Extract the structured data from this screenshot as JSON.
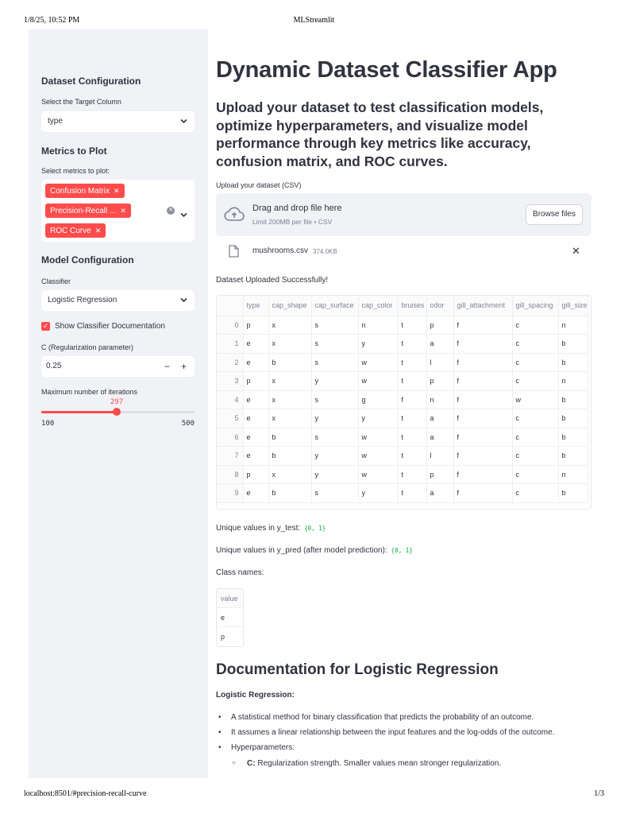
{
  "print_header": {
    "datetime": "1/8/25, 10:52 PM",
    "title": "MLStreamlit"
  },
  "print_footer": {
    "url": "localhost:8501/#precision-recall-curve",
    "page": "1/3"
  },
  "sidebar": {
    "dataset_config": {
      "heading": "Dataset Configuration",
      "target_label": "Select the Target Column",
      "target_value": "type"
    },
    "metrics": {
      "heading": "Metrics to Plot",
      "label": "Select metrics to plot:",
      "selected": [
        "Confusion Matrix",
        "Precision-Recall ...",
        "ROC Curve"
      ]
    },
    "model_config": {
      "heading": "Model Configuration",
      "classifier_label": "Classifier",
      "classifier_value": "Logistic Regression",
      "show_docs_label": "Show Classifier Documentation",
      "show_docs_checked": true,
      "c_label": "C (Regularization parameter)",
      "c_value": "0.25",
      "iter_label": "Maximum number of iterations",
      "iter_value": "297",
      "iter_min": "100",
      "iter_max": "500"
    }
  },
  "main": {
    "title": "Dynamic Dataset Classifier App",
    "subtitle": "Upload your dataset to test classification models, optimize hyperparameters, and visualize model performance through key metrics like accuracy, confusion matrix, and ROC curves.",
    "upload": {
      "label": "Upload your dataset (CSV)",
      "drag_text": "Drag and drop file here",
      "limit_text": "Limit 200MB per file • CSV",
      "browse_label": "Browse files",
      "file_name": "mushrooms.csv",
      "file_size": "374.0KB"
    },
    "uploaded_msg": "Dataset Uploaded Successfully!",
    "dataframe": {
      "columns": [
        "type",
        "cap_shape",
        "cap_surface",
        "cap_color",
        "bruises",
        "odor",
        "gill_attachment",
        "gill_spacing",
        "gill_size"
      ],
      "rows": [
        {
          "idx": "0",
          "cells": [
            "p",
            "x",
            "s",
            "n",
            "t",
            "p",
            "f",
            "c",
            "n"
          ]
        },
        {
          "idx": "1",
          "cells": [
            "e",
            "x",
            "s",
            "y",
            "t",
            "a",
            "f",
            "c",
            "b"
          ]
        },
        {
          "idx": "2",
          "cells": [
            "e",
            "b",
            "s",
            "w",
            "t",
            "l",
            "f",
            "c",
            "b"
          ]
        },
        {
          "idx": "3",
          "cells": [
            "p",
            "x",
            "y",
            "w",
            "t",
            "p",
            "f",
            "c",
            "n"
          ]
        },
        {
          "idx": "4",
          "cells": [
            "e",
            "x",
            "s",
            "g",
            "f",
            "n",
            "f",
            "w",
            "b"
          ]
        },
        {
          "idx": "5",
          "cells": [
            "e",
            "x",
            "y",
            "y",
            "t",
            "a",
            "f",
            "c",
            "b"
          ]
        },
        {
          "idx": "6",
          "cells": [
            "e",
            "b",
            "s",
            "w",
            "t",
            "a",
            "f",
            "c",
            "b"
          ]
        },
        {
          "idx": "7",
          "cells": [
            "e",
            "b",
            "y",
            "w",
            "t",
            "l",
            "f",
            "c",
            "b"
          ]
        },
        {
          "idx": "8",
          "cells": [
            "p",
            "x",
            "y",
            "w",
            "t",
            "p",
            "f",
            "c",
            "n"
          ]
        },
        {
          "idx": "9",
          "cells": [
            "e",
            "b",
            "s",
            "y",
            "t",
            "a",
            "f",
            "c",
            "b"
          ]
        }
      ]
    },
    "unique_test_label": "Unique values in y_test:",
    "unique_test_value": "{0, 1}",
    "unique_pred_label": "Unique values in y_pred (after model prediction):",
    "unique_pred_value": "{0, 1}",
    "class_names_label": "Class names:",
    "class_names": {
      "header": "value",
      "values": [
        "e",
        "p"
      ]
    },
    "docs": {
      "title": "Documentation for Logistic Regression",
      "subtitle": "Logistic Regression:",
      "bullets": [
        "A statistical method for binary classification that predicts the probability of an outcome.",
        "It assumes a linear relationship between the input features and the log-odds of the outcome.",
        "Hyperparameters:"
      ],
      "sub_bullet_label": "C:",
      "sub_bullet_text": "Regularization strength. Smaller values mean stronger regularization."
    }
  },
  "colors": {
    "accent": "#ff4b4b",
    "sidebar_bg": "#f0f2f6",
    "text": "#31333f"
  }
}
